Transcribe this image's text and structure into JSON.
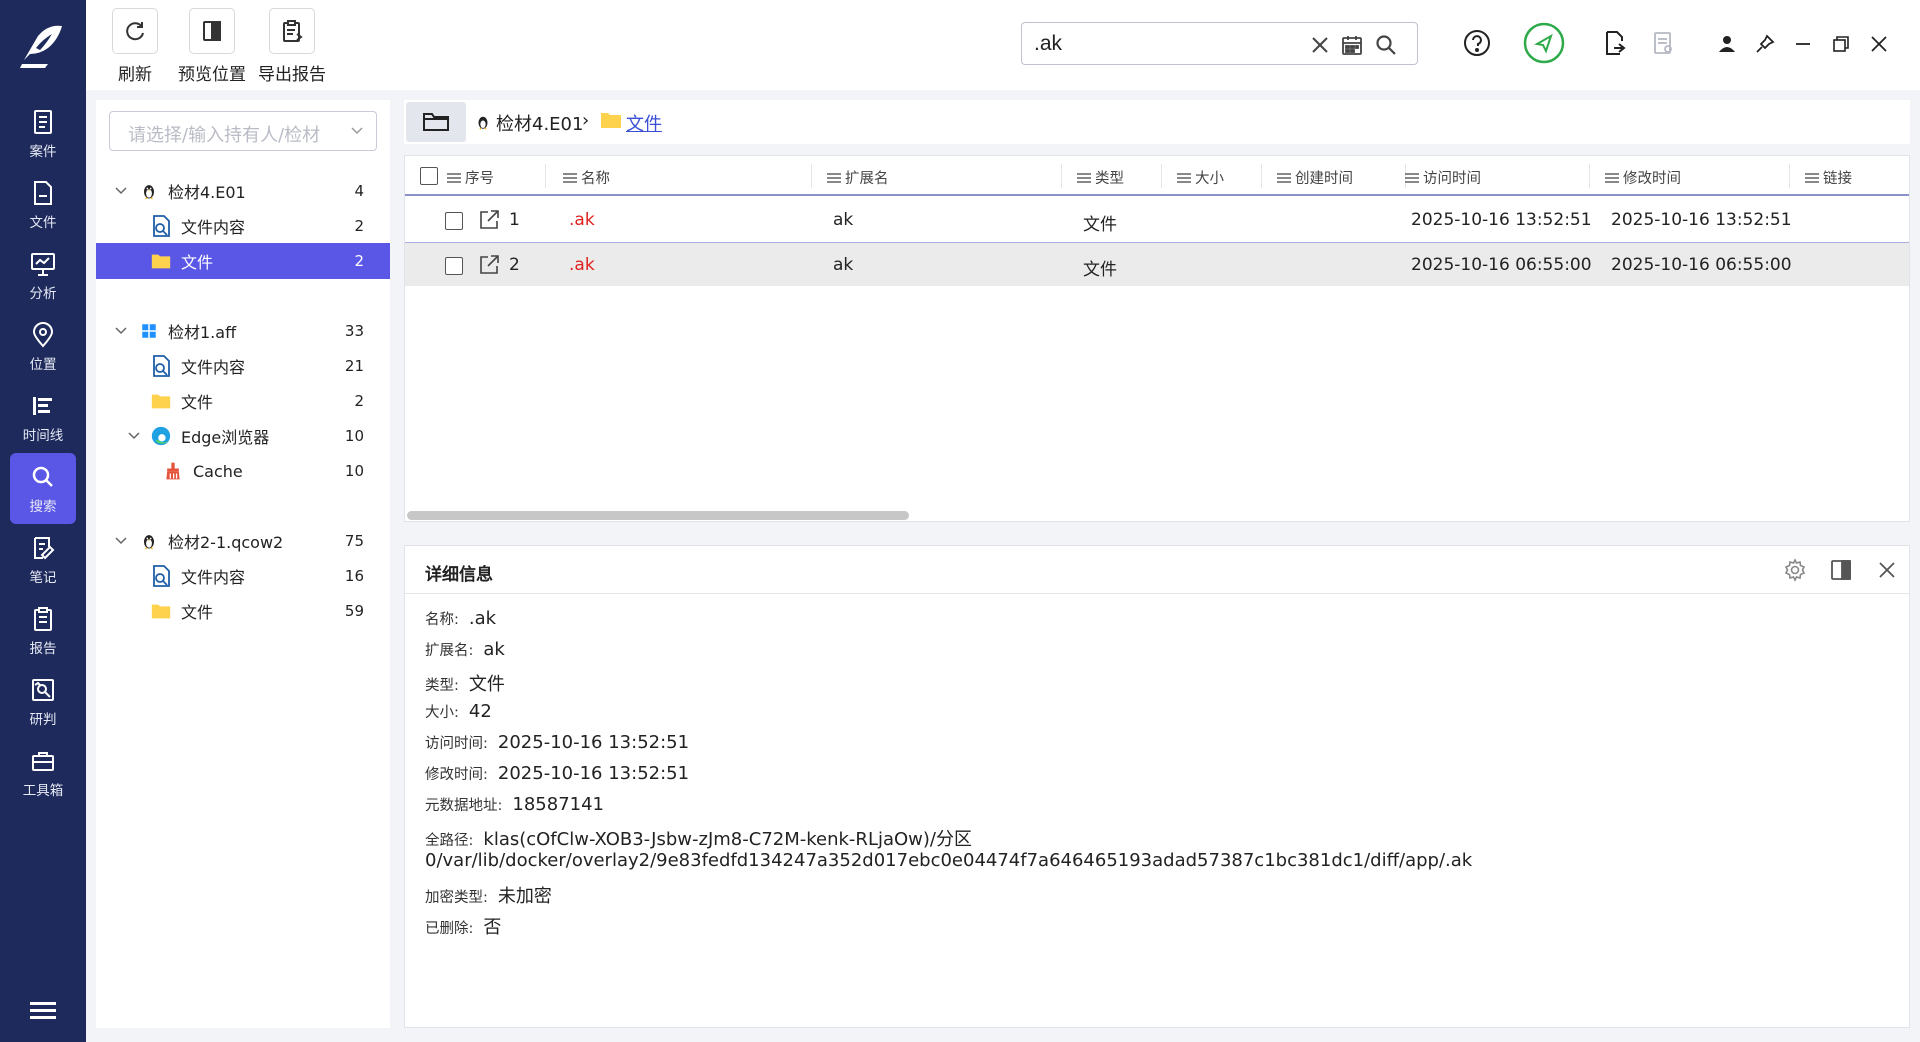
{
  "toolbar": {
    "refresh": "刷新",
    "preview": "预览位置",
    "export": "导出报告"
  },
  "search": {
    "value": ".ak"
  },
  "nav": {
    "case": "案件",
    "file": "文件",
    "analysis": "分析",
    "location": "位置",
    "timeline": "时间线",
    "search": "搜索",
    "notes": "笔记",
    "report": "报告",
    "research": "研判",
    "tools": "工具箱"
  },
  "tree": {
    "selector_placeholder": "请选择/输入持有人/检材",
    "nodes": [
      {
        "label": "检材4.E01",
        "count": "4"
      },
      {
        "label": "文件内容",
        "count": "2"
      },
      {
        "label": "文件",
        "count": "2"
      },
      {
        "label": "检材1.aff",
        "count": "33"
      },
      {
        "label": "文件内容",
        "count": "21"
      },
      {
        "label": "文件",
        "count": "2"
      },
      {
        "label": "Edge浏览器",
        "count": "10"
      },
      {
        "label": "Cache",
        "count": "10"
      },
      {
        "label": "检材2-1.qcow2",
        "count": "75"
      },
      {
        "label": "文件内容",
        "count": "16"
      },
      {
        "label": "文件",
        "count": "59"
      }
    ]
  },
  "breadcrumb": {
    "source": "检材4.E01",
    "sep": "›",
    "current": "文件"
  },
  "table": {
    "columns": [
      "序号",
      "名称",
      "扩展名",
      "类型",
      "大小",
      "创建时间",
      "访问时间",
      "修改时间",
      "链接"
    ],
    "rows": [
      {
        "index": "1",
        "name": ".ak",
        "ext": "ak",
        "type": "文件",
        "size": "",
        "created": "",
        "accessed": "2025-10-16 13:52:51",
        "modified": "2025-10-16 13:52:51"
      },
      {
        "index": "2",
        "name": ".ak",
        "ext": "ak",
        "type": "文件",
        "size": "",
        "created": "",
        "accessed": "2025-10-16 06:55:00",
        "modified": "2025-10-16 06:55:00"
      }
    ]
  },
  "detail": {
    "title": "详细信息",
    "fields": [
      {
        "k": "名称:",
        "v": ".ak"
      },
      {
        "k": "扩展名:",
        "v": "ak"
      },
      {
        "k": "类型:",
        "v": "文件"
      },
      {
        "k": "大小:",
        "v": "42"
      },
      {
        "k": "访问时间:",
        "v": "2025-10-16 13:52:51"
      },
      {
        "k": "修改时间:",
        "v": "2025-10-16 13:52:51"
      },
      {
        "k": "元数据地址:",
        "v": "18587141"
      },
      {
        "k": "全路径:",
        "v": "klas(cOfClw-XOB3-Jsbw-zJm8-C72M-kenk-RLjaOw)/分区"
      },
      {
        "k": "加密类型:",
        "v": "未加密"
      },
      {
        "k": "已删除:",
        "v": "否"
      }
    ],
    "path_line2": "0/var/lib/docker/overlay2/9e83fedfd134247a352d017ebc0e04474f7a646465193adad57387c1bc381dc1/diff/app/.ak"
  }
}
